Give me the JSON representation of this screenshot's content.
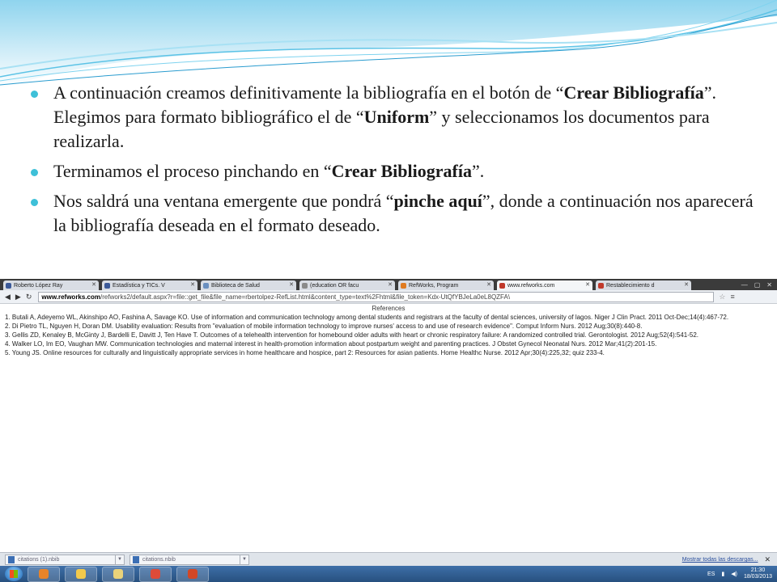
{
  "bullets": [
    {
      "segments": [
        {
          "text": "A continuación creamos definitivamente la bibliografía en el botón de “",
          "bold": false
        },
        {
          "text": "Crear Bibliografía",
          "bold": true
        },
        {
          "text": "”. Elegimos para formato bibliográfico el de “",
          "bold": false
        },
        {
          "text": "Uniform",
          "bold": true
        },
        {
          "text": "” y seleccionamos los documentos para realizarla.",
          "bold": false
        }
      ]
    },
    {
      "segments": [
        {
          "text": "Terminamos el proceso pinchando en “",
          "bold": false
        },
        {
          "text": "Crear Bibliografía",
          "bold": true
        },
        {
          "text": "”.",
          "bold": false
        }
      ]
    },
    {
      "segments": [
        {
          "text": "Nos saldrá una ventana emergente que pondrá “",
          "bold": false
        },
        {
          "text": "pinche aquí",
          "bold": true
        },
        {
          "text": "”, donde a continuación nos aparecerá la bibliografía deseada en el formato deseado.",
          "bold": false
        }
      ]
    }
  ],
  "browser": {
    "tabs": [
      {
        "label": "Roberto López Ray",
        "color": "#3b5998"
      },
      {
        "label": "Estadística y TICs. V",
        "color": "#3b5998"
      },
      {
        "label": "Biblioteca de Salud",
        "color": "#6a8fbf"
      },
      {
        "label": "(education OR facu",
        "color": "#8a8a8a"
      },
      {
        "label": "RefWorks, Program",
        "color": "#e07b20"
      },
      {
        "label": "www.refworks.com",
        "color": "#c0392b"
      },
      {
        "label": "Restablecimiento d",
        "color": "#c0392b"
      }
    ],
    "url_domain": "www.refworks.com",
    "url_path": "/refworks2/default.aspx?r=file::get_file&file_name=rbertolpez-RefList.html&content_type=text%2Fhtml&file_token=Kdx-UtQfYBJeLa0eL8QZFA\\",
    "page_title": "References",
    "references": [
      "1. Butali A, Adeyemo WL, Akinshipo AO, Fashina A, Savage KO. Use of information and communication technology among dental students and registrars at the faculty of dental sciences, university of lagos. Niger J Clin Pract. 2011 Oct-Dec;14(4):467-72.",
      "2. Di Pietro TL, Nguyen H, Doran DM. Usability evaluation: Results from \"evaluation of mobile information technology to improve nurses' access to and use of research evidence\". Comput Inform Nurs. 2012 Aug;30(8):440-8.",
      "3. Gellis ZD, Kenaley B, McGinty J, Bardelli E, Davitt J, Ten Have T. Outcomes of a telehealth intervention for homebound older adults with heart or chronic respiratory failure: A randomized controlled trial. Gerontologist. 2012 Aug;52(4):541-52.",
      "4. Walker LO, Im EO, Vaughan MW. Communication technologies and maternal interest in health-promotion information about postpartum weight and parenting practices. J Obstet Gynecol Neonatal Nurs. 2012 Mar;41(2):201-15.",
      "5. Young JS. Online resources for culturally and linguistically appropriate services in home healthcare and hospice, part 2: Resources for asian patients. Home Healthc Nurse. 2012 Apr;30(4):225,32; quiz 233-4."
    ],
    "downloads": [
      {
        "label": "citations (1).nbib"
      },
      {
        "label": "citations.nbib"
      }
    ],
    "show_all_downloads": "Mostrar todas las descargas...",
    "icons": {
      "back": "arrow-left-icon",
      "forward": "arrow-right-icon",
      "reload": "reload-icon",
      "star": "star-icon",
      "menu": "wrench-icon"
    }
  },
  "taskbar": {
    "language": "ES",
    "time": "21:30",
    "date": "18/03/2013",
    "apps": [
      {
        "name": "windows-media-player-icon",
        "color": "#e8842a"
      },
      {
        "name": "folder-icon",
        "color": "#f2c94c"
      },
      {
        "name": "file-manager-icon",
        "color": "#e9d27a"
      },
      {
        "name": "chrome-icon",
        "color": "#dd4b39"
      },
      {
        "name": "presentation-icon",
        "color": "#d24726"
      }
    ]
  },
  "colors": {
    "accent": "#3ec0d8",
    "taskbar": "#2f5c92"
  }
}
